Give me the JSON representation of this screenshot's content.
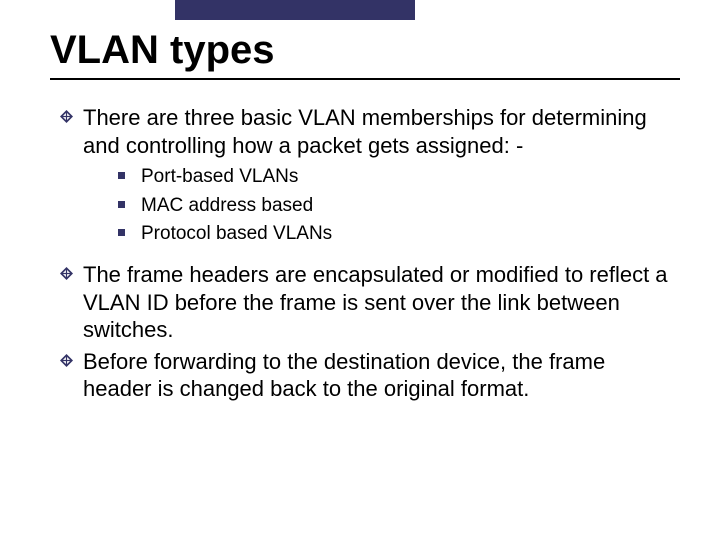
{
  "title": "VLAN types",
  "bullets": {
    "b1": "There are three basic VLAN memberships for determining and controlling how a packet gets assigned:  -",
    "sub": {
      "s1": "Port-based VLANs",
      "s2": "MAC address based",
      "s3": "Protocol based VLANs"
    },
    "b2": "The frame headers are encapsulated or modified to reflect a VLAN ID before the frame is sent over the link between switches.",
    "b3": "Before forwarding to the destination device, the frame header is changed back to the original format."
  },
  "colors": {
    "accent": "#333366"
  }
}
